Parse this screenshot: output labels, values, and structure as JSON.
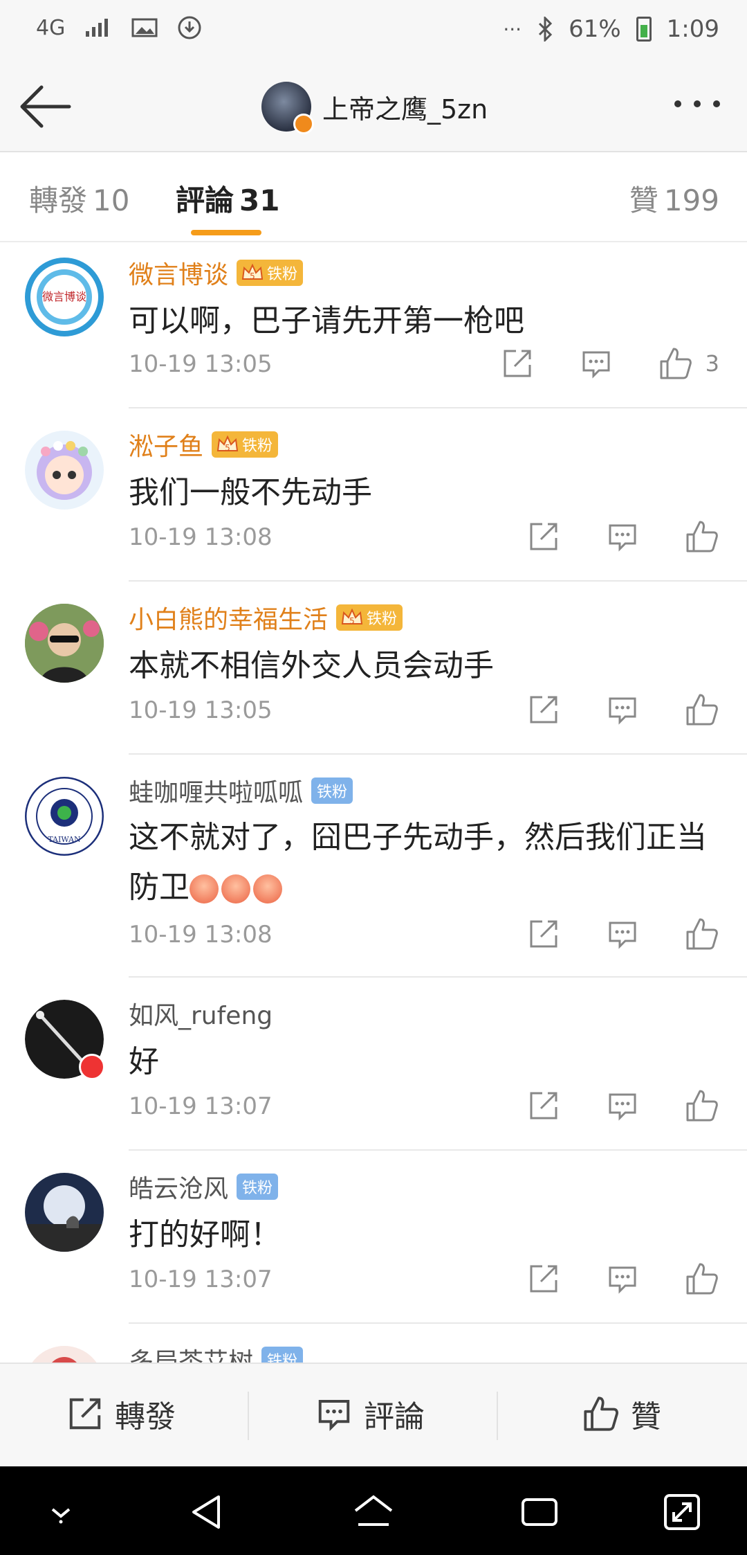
{
  "status_bar": {
    "network": "4G",
    "battery_pct": "61%",
    "time": "1:09",
    "dots": "···"
  },
  "header": {
    "title": "上帝之鹰_5zn"
  },
  "tabs": [
    {
      "label": "轉發",
      "count": "10"
    },
    {
      "label": "評論",
      "count": "31"
    },
    {
      "label": "贊",
      "count": "199"
    }
  ],
  "badge_label": "铁粉",
  "comments": [
    {
      "name": "微言博谈",
      "text": "可以啊，巴子请先开第一枪吧",
      "time": "10-19 13:05",
      "likes": "3",
      "avatar_text": "微言博谈"
    },
    {
      "name": "淞子鱼",
      "text": "我们一般不先动手",
      "time": "10-19 13:08",
      "likes": ""
    },
    {
      "name": "小白熊的幸福生活",
      "text": "本就不相信外交人员会动手",
      "time": "10-19 13:05",
      "likes": ""
    },
    {
      "name": "蛙咖喱共啦呱呱",
      "text": "这不就对了，囧巴子先动手，然后我们正当防卫",
      "time": "10-19 13:08",
      "likes": "",
      "avatar_text": "TAIWAN"
    },
    {
      "name": "如风_rufeng",
      "text": "好",
      "time": "10-19 13:07",
      "likes": ""
    },
    {
      "name": "皓云沧风",
      "text": "打的好啊！",
      "time": "10-19 13:07",
      "likes": ""
    },
    {
      "name": "多局茶艾树",
      "text": "",
      "time": "",
      "likes": ""
    }
  ],
  "bottom_bar": {
    "repost": "轉發",
    "comment": "評論",
    "like": "贊"
  },
  "colors": {
    "accent": "#f59c1a",
    "gold_name": "#e0801a",
    "badge_gold": "#f4b63a",
    "badge_blue": "#7fb2ea"
  }
}
